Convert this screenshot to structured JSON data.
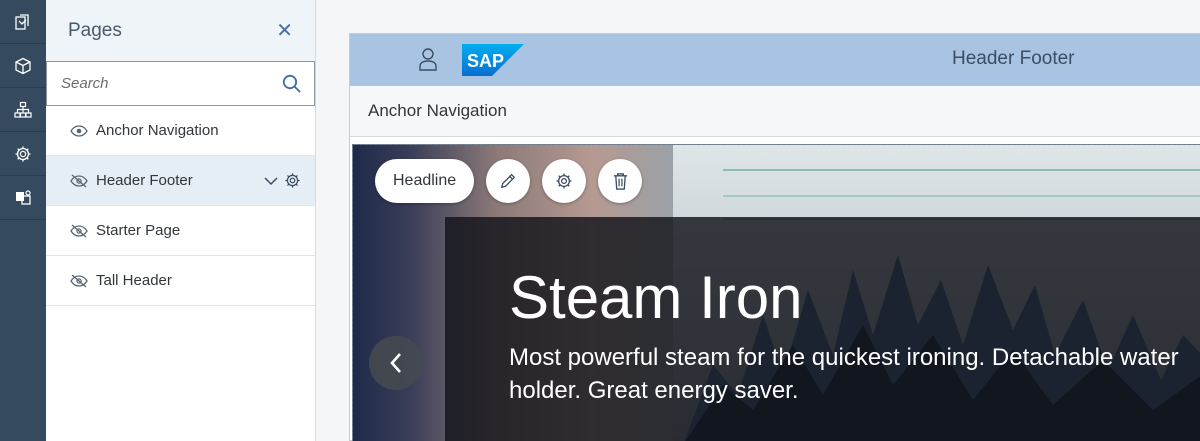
{
  "panel": {
    "title": "Pages",
    "close_icon": "close-icon",
    "search": {
      "placeholder": "Search",
      "value": ""
    },
    "pages": [
      {
        "label": "Anchor Navigation",
        "visibility_icon": "eye-icon"
      },
      {
        "label": "Header Footer",
        "visibility_icon": "eye-hidden-icon",
        "selected": true
      },
      {
        "label": "Starter Page",
        "visibility_icon": "eye-hidden-icon"
      },
      {
        "label": "Tall Header",
        "visibility_icon": "eye-hidden-icon"
      }
    ]
  },
  "rail": {
    "items": [
      "pages-icon",
      "cube-icon",
      "hierarchy-icon",
      "settings-icon",
      "theme-icon"
    ]
  },
  "preview": {
    "header_title": "Header Footer",
    "logo_text": "SAP",
    "anchor_nav_label": "Anchor Navigation",
    "hero": {
      "title": "Steam Iron",
      "text": "Most powerful steam for the quickest ironing. Detachable water holder. Great energy saver."
    },
    "edit_toolbar": {
      "chip_label": "Headline",
      "buttons": [
        "edit-icon",
        "settings-icon",
        "delete-icon"
      ]
    }
  },
  "colors": {
    "rail_bg": "#354a5f",
    "panel_header_bg": "#eff4f9",
    "app_header_bg": "#a9c4e3",
    "selected_row_bg": "#e5edf5",
    "sap_blue": "#1a7ad1"
  }
}
